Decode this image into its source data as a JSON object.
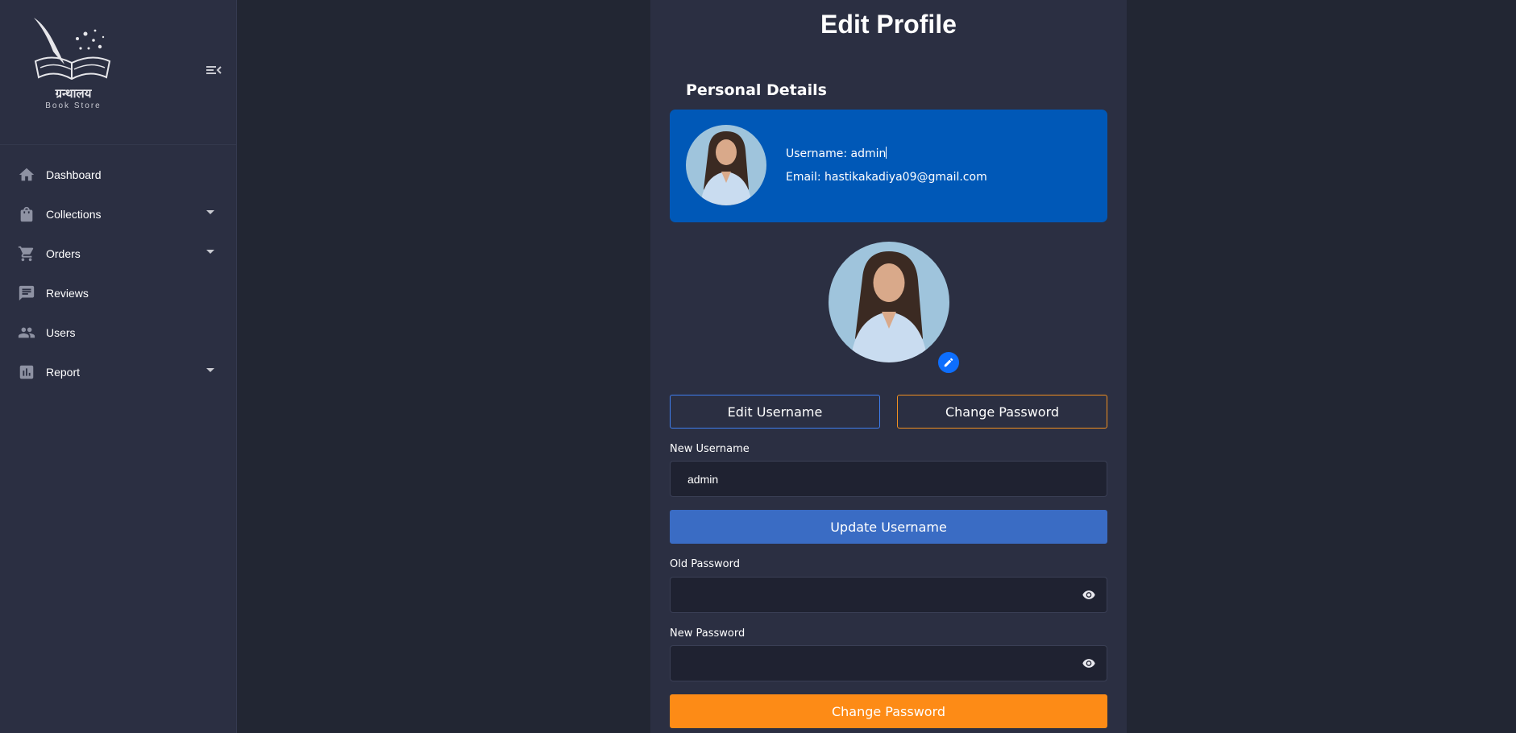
{
  "sidebar": {
    "logo": {
      "title": "ग्रन्थालय",
      "subtitle": "Book Store"
    },
    "items": [
      {
        "label": "Dashboard",
        "icon": "home-icon"
      },
      {
        "label": "Collections",
        "icon": "bag-icon",
        "has_dropdown": true
      },
      {
        "label": "Orders",
        "icon": "cart-icon",
        "has_dropdown": true
      },
      {
        "label": "Reviews",
        "icon": "comment-icon"
      },
      {
        "label": "Users",
        "icon": "users-icon"
      },
      {
        "label": "Report",
        "icon": "chart-icon",
        "has_dropdown": true
      }
    ]
  },
  "main": {
    "title": "Edit Profile",
    "section_title": "Personal Details",
    "card": {
      "username_line": "Username: admin",
      "email_line": "Email: hastikakadiya09@gmail.com"
    },
    "tabs": {
      "edit_username": "Edit Username",
      "change_password": "Change Password"
    },
    "form": {
      "new_username_label": "New Username",
      "new_username_value": "admin",
      "update_button": "Update Username",
      "old_password_label": "Old Password",
      "new_password_label": "New Password",
      "change_button": "Change Password"
    }
  },
  "colors": {
    "background": "#222633",
    "panel": "#2b2f42",
    "card": "#0058b7",
    "primary": "#3a6cc4",
    "accent": "#fd8b16"
  }
}
